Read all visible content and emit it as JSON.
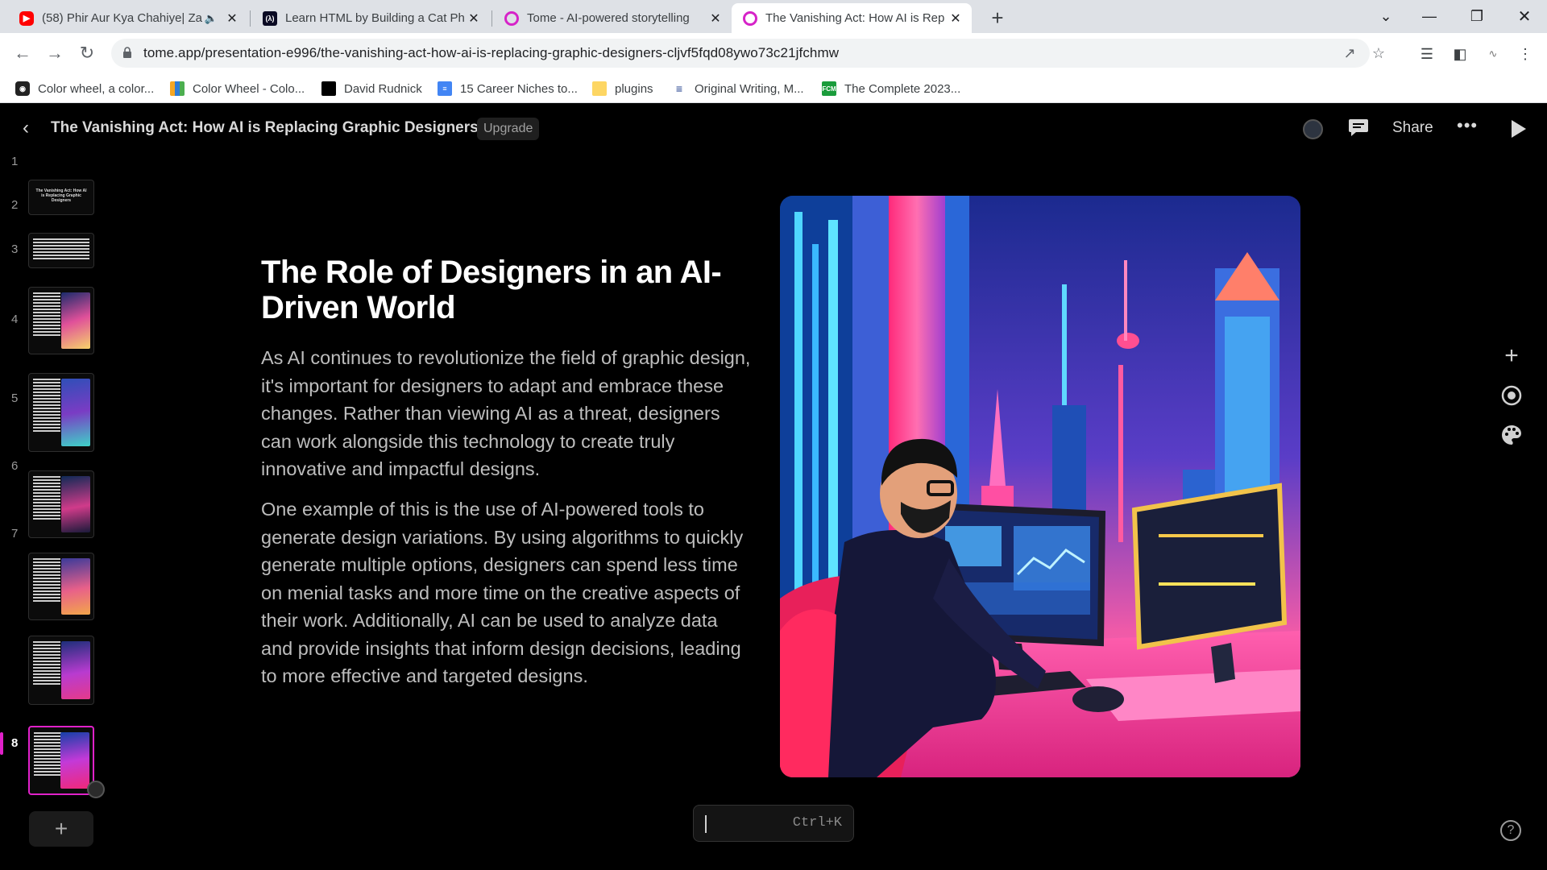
{
  "browser": {
    "tabs": [
      {
        "title": "(58) Phir Aur Kya Chahiye| Za",
        "favicon": "youtube-icon",
        "active": false
      },
      {
        "title": "Learn HTML by Building a Cat Ph",
        "favicon": "freecodecamp-icon",
        "active": false
      },
      {
        "title": "Tome - AI-powered storytelling",
        "favicon": "tome-icon",
        "active": false
      },
      {
        "title": "The Vanishing Act: How AI is Rep",
        "favicon": "tome-icon",
        "active": true
      }
    ],
    "url": "tome.app/presentation-e996/the-vanishing-act-how-ai-is-replacing-graphic-designers-cljvf5fqd08ywo73c21jfchmw",
    "bookmarks": [
      {
        "label": "Color wheel, a color...",
        "icon": "color-wheel-icon"
      },
      {
        "label": "Color Wheel - Colo...",
        "icon": "canva-icon"
      },
      {
        "label": "David Rudnick",
        "icon": "square-icon"
      },
      {
        "label": "15 Career Niches to...",
        "icon": "docs-icon"
      },
      {
        "label": "plugins",
        "icon": "folder-icon"
      },
      {
        "label": "Original Writing, M...",
        "icon": "lines-icon"
      },
      {
        "label": "The Complete 2023...",
        "icon": "fcm-icon"
      }
    ]
  },
  "app": {
    "title": "The Vanishing Act: How AI is Replacing Graphic Designers",
    "upgrade_label": "Upgrade",
    "share_label": "Share",
    "active_page": 8,
    "pages": [
      "1",
      "2",
      "3",
      "4",
      "5",
      "6",
      "7",
      "8"
    ],
    "thumb1_text": "The Vanishing Act: How AI is Replacing Graphic Designers",
    "command_hint": "Ctrl+K"
  },
  "slide": {
    "title": "The Role of Designers in an AI-Driven World",
    "paragraphs": [
      "As AI continues to revolutionize the field of graphic design, it's important for designers to adapt and embrace these changes. Rather than viewing AI as a threat, designers can work alongside this technology to create truly innovative and impactful designs.",
      "One example of this is the use of AI-powered tools to generate design variations. By using algorithms to quickly generate multiple options, designers can spend less time on menial tasks and more time on the creative aspects of their work. Additionally, AI can be used to analyze data and provide insights that inform design decisions, leading to more effective and targeted designs."
    ]
  },
  "colors": {
    "accent": "#e021c9",
    "background": "#000000",
    "tab_strip": "#dee1e6"
  }
}
